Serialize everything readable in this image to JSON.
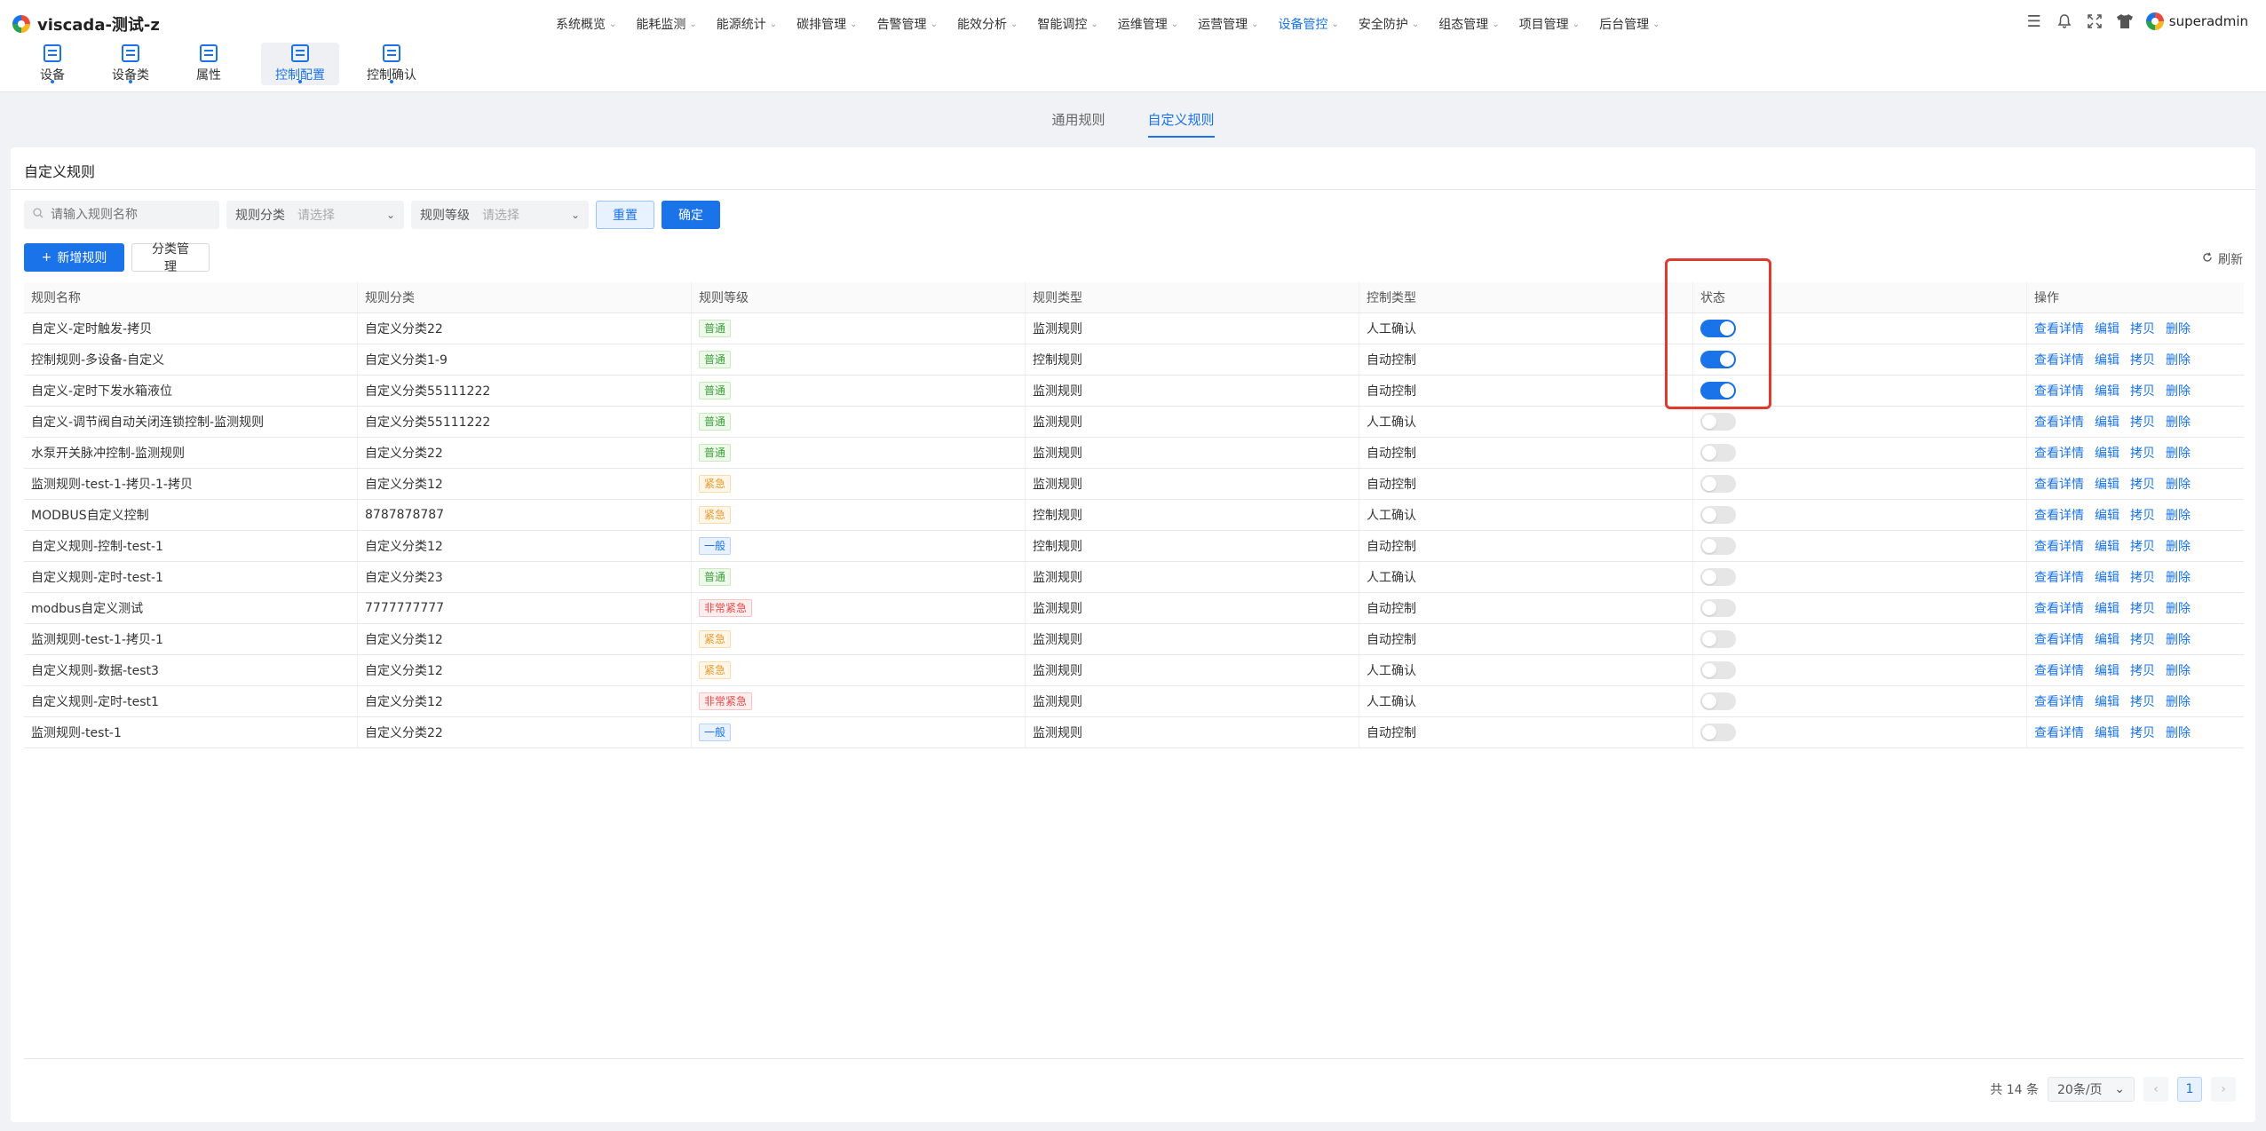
{
  "app": {
    "title": "viscada-测试-z"
  },
  "mainnav": [
    {
      "label": "系统概览",
      "active": false
    },
    {
      "label": "能耗监测",
      "active": false
    },
    {
      "label": "能源统计",
      "active": false
    },
    {
      "label": "碳排管理",
      "active": false
    },
    {
      "label": "告警管理",
      "active": false
    },
    {
      "label": "能效分析",
      "active": false
    },
    {
      "label": "智能调控",
      "active": false
    },
    {
      "label": "运维管理",
      "active": false
    },
    {
      "label": "运营管理",
      "active": false
    },
    {
      "label": "设备管控",
      "active": true
    },
    {
      "label": "安全防护",
      "active": false
    },
    {
      "label": "组态管理",
      "active": false
    },
    {
      "label": "项目管理",
      "active": false
    },
    {
      "label": "后台管理",
      "active": false
    }
  ],
  "user": {
    "name": "superadmin"
  },
  "subnav": [
    {
      "label": "设备"
    },
    {
      "label": "设备类"
    },
    {
      "label": "属性"
    },
    {
      "label": "控制配置"
    },
    {
      "label": "控制确认"
    }
  ],
  "tabs": [
    {
      "label": "通用规则"
    },
    {
      "label": "自定义规则"
    }
  ],
  "card": {
    "title": "自定义规则",
    "search_placeholder": "请输入规则名称",
    "filter_category_label": "规则分类",
    "filter_level_label": "规则等级",
    "select_placeholder": "请选择",
    "reset_label": "重置",
    "confirm_label": "确定",
    "add_label": "新增规则",
    "category_manage_label": "分类管理",
    "refresh_label": "刷新"
  },
  "table": {
    "headers": [
      "规则名称",
      "规则分类",
      "规则等级",
      "规则类型",
      "控制类型",
      "状态",
      "操作"
    ],
    "ops": [
      "查看详情",
      "编辑",
      "拷贝",
      "删除"
    ],
    "rows": [
      {
        "name": "自定义-定时触发-拷贝",
        "category": "自定义分类22",
        "level": "普通",
        "level_color": "green",
        "type": "监测规则",
        "control": "人工确认",
        "enabled": true
      },
      {
        "name": "控制规则-多设备-自定义",
        "category": "自定义分类1-9",
        "level": "普通",
        "level_color": "green",
        "type": "控制规则",
        "control": "自动控制",
        "enabled": true
      },
      {
        "name": "自定义-定时下发水箱液位",
        "category": "自定义分类55111222",
        "level": "普通",
        "level_color": "green",
        "type": "监测规则",
        "control": "自动控制",
        "enabled": true
      },
      {
        "name": "自定义-调节阀自动关闭连锁控制-监测规则",
        "category": "自定义分类55111222",
        "level": "普通",
        "level_color": "green",
        "type": "监测规则",
        "control": "人工确认",
        "enabled": false
      },
      {
        "name": "水泵开关脉冲控制-监测规则",
        "category": "自定义分类22",
        "level": "普通",
        "level_color": "green",
        "type": "监测规则",
        "control": "自动控制",
        "enabled": false
      },
      {
        "name": "监测规则-test-1-拷贝-1-拷贝",
        "category": "自定义分类12",
        "level": "紧急",
        "level_color": "orange",
        "type": "监测规则",
        "control": "自动控制",
        "enabled": false
      },
      {
        "name": "MODBUS自定义控制",
        "category": "8787878787",
        "level": "紧急",
        "level_color": "orange",
        "type": "控制规则",
        "control": "人工确认",
        "enabled": false
      },
      {
        "name": "自定义规则-控制-test-1",
        "category": "自定义分类12",
        "level": "一般",
        "level_color": "blue",
        "type": "控制规则",
        "control": "自动控制",
        "enabled": false
      },
      {
        "name": "自定义规则-定时-test-1",
        "category": "自定义分类23",
        "level": "普通",
        "level_color": "green",
        "type": "监测规则",
        "control": "人工确认",
        "enabled": false
      },
      {
        "name": "modbus自定义测试",
        "category": "7777777777",
        "level": "非常紧急",
        "level_color": "red",
        "type": "监测规则",
        "control": "自动控制",
        "enabled": false
      },
      {
        "name": "监测规则-test-1-拷贝-1",
        "category": "自定义分类12",
        "level": "紧急",
        "level_color": "orange",
        "type": "监测规则",
        "control": "自动控制",
        "enabled": false
      },
      {
        "name": "自定义规则-数据-test3",
        "category": "自定义分类12",
        "level": "紧急",
        "level_color": "orange",
        "type": "监测规则",
        "control": "人工确认",
        "enabled": false
      },
      {
        "name": "自定义规则-定时-test1",
        "category": "自定义分类12",
        "level": "非常紧急",
        "level_color": "red",
        "type": "监测规则",
        "control": "人工确认",
        "enabled": false
      },
      {
        "name": "监测规则-test-1",
        "category": "自定义分类22",
        "level": "一般",
        "level_color": "blue",
        "type": "监测规则",
        "control": "自动控制",
        "enabled": false
      }
    ]
  },
  "pager": {
    "total_label": "共 14 条",
    "size_label": "20条/页",
    "current_page": "1"
  },
  "colors": {
    "accent": "#1a73e8",
    "highlight": "#e0392f"
  }
}
